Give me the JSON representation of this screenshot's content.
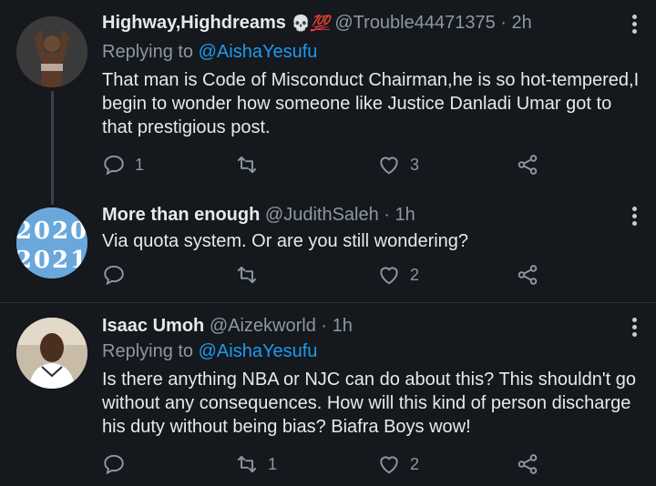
{
  "tweets": [
    {
      "name": "Highway,Highdreams",
      "emoji_skull": "💀",
      "emoji_100": "💯",
      "handle": "@Trouble44471375",
      "time": "· 2h",
      "replying_prefix": "Replying to ",
      "replying_to": "@AishaYesufu",
      "text": "That man is Code of Misconduct Chairman,he is so hot-tempered,I begin to wonder how someone like Justice Danladi Umar got to that prestigious post.",
      "replies": "1",
      "retweets": "",
      "likes": "3"
    },
    {
      "name": "More than enough",
      "handle": "@JudithSaleh",
      "time": "· 1h",
      "text": "Via quota system. Or are you still wondering?",
      "avatar_text_top": "2020",
      "avatar_text_bottom": "2021",
      "replies": "",
      "retweets": "",
      "likes": "2"
    },
    {
      "name": "Isaac Umoh",
      "handle": "@Aizekworld",
      "time": "· 1h",
      "replying_prefix": "Replying to ",
      "replying_to": "@AishaYesufu",
      "text": "Is there anything NBA or NJC can do about this? This shouldn't go without any consequences. How will this kind of person discharge his duty without being bias? Biafra Boys wow!",
      "replies": "",
      "retweets": "1",
      "likes": "2"
    }
  ],
  "colors": {
    "background": "#15181c",
    "link": "#1d9bf0",
    "muted": "#8b98a5",
    "text": "#e7e9ea"
  },
  "icons": [
    "reply-icon",
    "retweet-icon",
    "like-icon",
    "share-icon",
    "more-options-icon"
  ]
}
